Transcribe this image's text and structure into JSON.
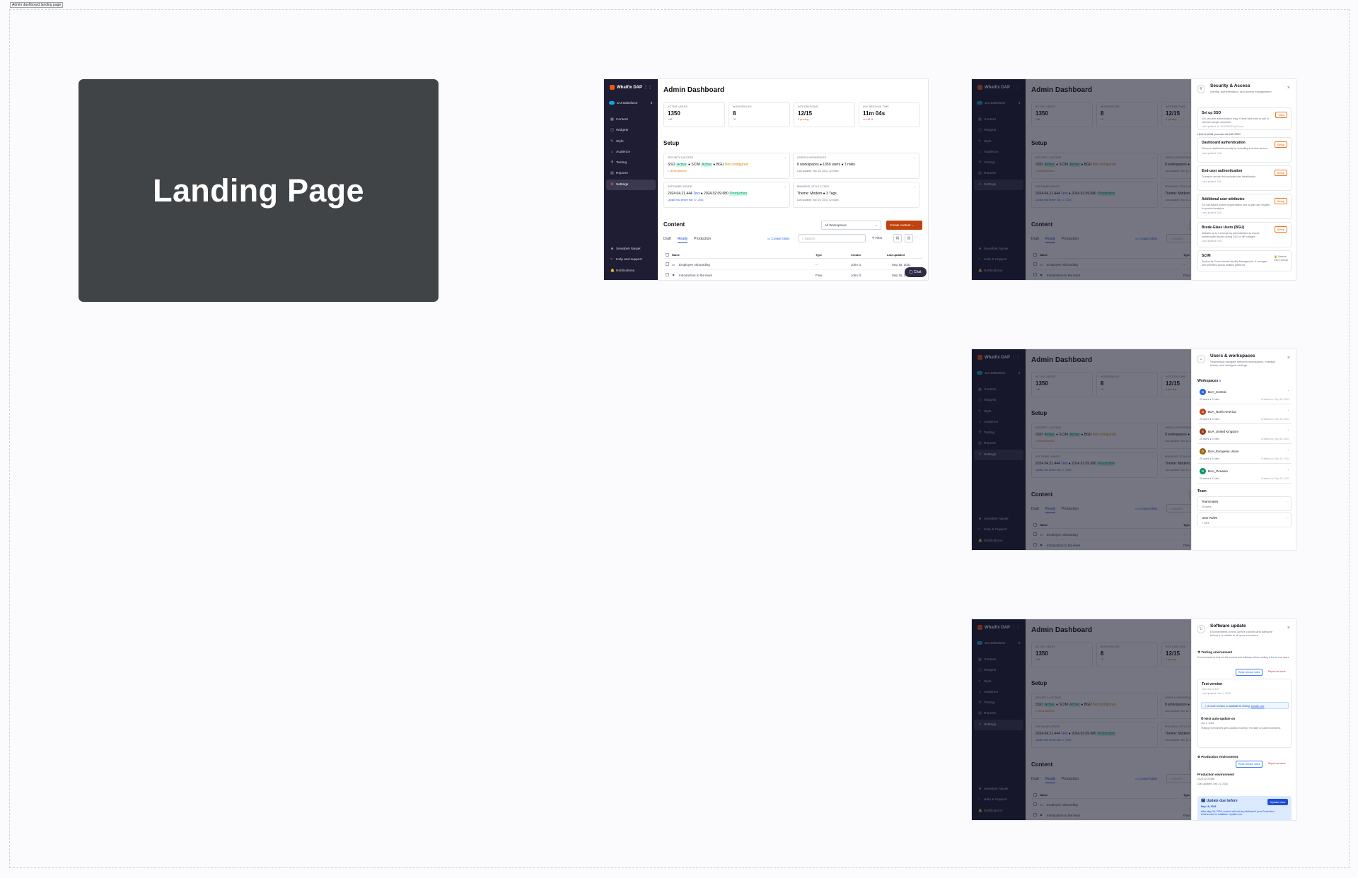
{
  "frame": {
    "label": "Admin dashboard landing page"
  },
  "landing": {
    "title": "Landing Page"
  },
  "sidebar": {
    "brand": "Whatfix DAP",
    "org": "JnJ Salesforce",
    "items": [
      "Content",
      "Widgets",
      "Style",
      "Audience",
      "Testing",
      "Reports",
      "Settings"
    ],
    "footer": [
      "Sewabek Nayak",
      "Help and support",
      "Notifications"
    ],
    "footer_alt": [
      "Sewabek Nayak",
      "Help & Support",
      "Notifications"
    ]
  },
  "dashboard": {
    "title": "Admin Dashboard",
    "stats": [
      {
        "label": "ACTIVE USERS",
        "value": "1350",
        "sub": "+48"
      },
      {
        "label": "WORKSPACES",
        "value": "8",
        "sub": "+5"
      },
      {
        "label": "INTEGRATIONS",
        "value": "12/15",
        "sub": "3 pending"
      },
      {
        "label": "AVG RESOLVE TIME",
        "value": "11m 04s",
        "sub": "▼1.42 %"
      }
    ],
    "setup_title": "Setup",
    "cards": [
      {
        "label": "SECURITY & ACCESS",
        "k1": "SSO",
        "v1": "Active",
        "k2": "SCIM",
        "v2": "Active",
        "k3": "BGU",
        "v3": "Not configured",
        "meta": "1 needs attention"
      },
      {
        "label": "USERS & WORKSPACES",
        "line": "8 workspaces ● 1350 users ● 7 roles",
        "meta": "Last updated: Sep 15, 2024, 12:00am"
      },
      {
        "label": "SOFTWARE UPDATE",
        "k1": "2024.04.21.444",
        "v1": "Test",
        "k2": "2024.02.09.680",
        "v2": "Production",
        "meta": "Update test before Mar 17, 2026"
      },
      {
        "label": "BRANDING, STYLE & TAGS",
        "line": "Theme: Modern ● 3 Tags",
        "meta": "Last updated: Sep 15, 2024, 12:00am"
      }
    ],
    "content_title": "Content",
    "workspace_select": "All Workspaces",
    "create_btn": "Create content",
    "tabs": [
      "Draft",
      "Ready",
      "Production"
    ],
    "create_folder": "Create folder",
    "search_placeholder": "Search",
    "filter": "Filter",
    "columns": [
      "Name",
      "Type",
      "Creator",
      "Last updated"
    ],
    "rows": [
      {
        "name": "Employee onboarding",
        "type": "--",
        "creator": "John G",
        "updated": "Sep 15, 2021"
      },
      {
        "name": "Introduction to the team",
        "type": "Flow",
        "creator": "John G",
        "updated": "Sep 15, 2021"
      }
    ],
    "chat": "Chat"
  },
  "security_panel": {
    "title": "Security & Access",
    "desc": "Identity, authentication, and access management",
    "sso": {
      "title": "Set up SSO",
      "desc": "You can start authentication easy. Create bank here to add or view the sample dropdown.",
      "meta": "Last updated on 10/29/2024 by Devon",
      "btn": "View"
    },
    "note": "Here is what you can do with SSO",
    "items": [
      {
        "title": "Dashboard authentication",
        "desc": "Enhance dashboard security by controlling end-user access.",
        "meta": "Last updated: N/A",
        "btn": "Setup"
      },
      {
        "title": "End-user authentication",
        "desc": "To ensure secure and accurate user identification",
        "meta": "Last updated: N/A",
        "btn": "Setup"
      },
      {
        "title": "Additional user attributes",
        "desc": "For role-based content segmentation and to gain user insights for product analytics",
        "meta": "Last updated: N/A",
        "btn": "Setup"
      },
      {
        "title": "Break-Glass Users (BGU)",
        "desc": "Maintain up to 3 emergency administrators to ensure uninterrupted access during SSO or IdP outages",
        "meta": "Last updated: N/A",
        "btn": "Setup"
      }
    ],
    "scim": {
      "title": "SCIM",
      "desc": "System for Cross-domain Identity Management. It manages user identities across multiple platforms",
      "lock": "Needs SSO Setup"
    }
  },
  "users_panel": {
    "title": "Users & workspaces",
    "desc": "Seamlessly navigate between workspaces, manage teams, and configure settings",
    "ws_label": "Workspaces",
    "ws_count": "5",
    "workspaces": [
      {
        "name": "BoA_Central",
        "letter": "B",
        "color": "#2563eb",
        "meta": "25 users ● 3 roles",
        "created": "Created on: Sep 15, 2021"
      },
      {
        "name": "BoA_North America",
        "letter": "B",
        "color": "#c2410c",
        "meta": "25 users ● 3 roles",
        "created": "Created on: Sep 15, 2021"
      },
      {
        "name": "BoA_United Kingdom",
        "letter": "B",
        "color": "#9a3412",
        "meta": "25 users ● 3 roles",
        "created": "Created on: Sep 15, 2021"
      },
      {
        "name": "BoA_European Union",
        "letter": "B",
        "color": "#a16207",
        "meta": "25 users ● 3 roles",
        "created": "Created on: Sep 15, 2021"
      },
      {
        "name": "BoA_Oceania",
        "letter": "B",
        "color": "#059669",
        "meta": "25 users ● 3 roles",
        "created": "Created on: Sep 15, 2021"
      }
    ],
    "team_label": "Team",
    "team": [
      {
        "title": "Teammates",
        "sub": "25 users"
      },
      {
        "title": "User Roles",
        "sub": "7 roles"
      }
    ]
  },
  "update_panel": {
    "title": "Software update",
    "desc": "Environments to test out the content and software before it is visible to all your end users",
    "test_env": {
      "title": "Testing environment",
      "desc": "Environments to test out the content and software before making it live to end users",
      "rn": "Read release notes",
      "report": "Report an issue"
    },
    "test_version": {
      "title": "Test version",
      "ver": "2024.04.21.444",
      "meta": "Last updated: Mar 1, 2026",
      "info": "A newer version is available for testing.",
      "link": "Update now"
    },
    "next_auto": {
      "title": "Next auto-update on",
      "date": "Jan 1, 2026",
      "desc": "Testing environment gets updated monthly. The date is pushed weekend."
    },
    "prod_env": {
      "title": "Production environment",
      "rn": "Read release notes",
      "report": "Report an issue"
    },
    "prod_version": {
      "title": "Production environment",
      "ver": "2024.02.09.680",
      "meta": "Last updated: Sep 11, 2026"
    },
    "alert": {
      "title": "Update due before",
      "date": "May 18, 2026",
      "desc": "After May 18, 2026, content will not be published if your Production environment is outdated. Update now.",
      "btn": "Update now"
    }
  }
}
